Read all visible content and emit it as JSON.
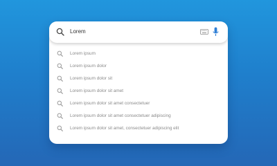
{
  "search": {
    "query": "Lorem",
    "icons": {
      "search": "search-icon",
      "keyboard": "keyboard-icon",
      "microphone": "microphone-icon"
    }
  },
  "suggestions": [
    "Lorem ipsum",
    "Lorem ipsum dolor",
    "Lorem ipsum dolor sit",
    "Lorem ipsum dolor sit amet",
    "Lorem ipsum dolor sit amet consectetuer",
    "Lorem ipsum dolor sit amet consectetuer adipiscing",
    "Lorem ipsum dolor sit amet, consectetuer adipiscing elit"
  ],
  "colors": {
    "background_top": "#2196dd",
    "background_bottom": "#2467b6",
    "mic_blue": "#2f7fd6",
    "suggestion_text": "#8a8a8a"
  }
}
